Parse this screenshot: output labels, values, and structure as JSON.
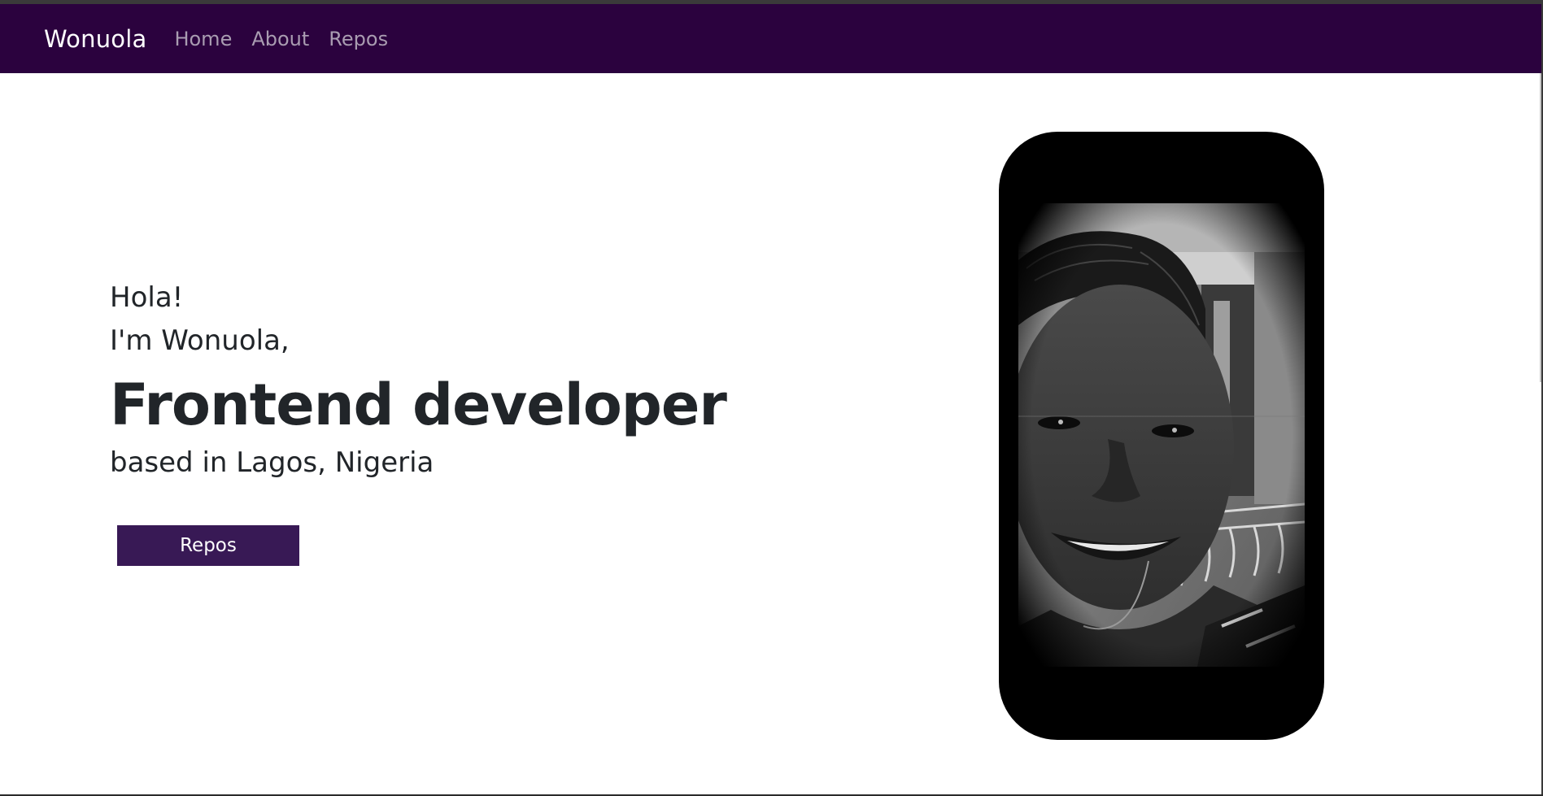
{
  "nav": {
    "brand": "Wonuola",
    "links": [
      {
        "label": "Home"
      },
      {
        "label": "About"
      },
      {
        "label": "Repos"
      }
    ],
    "background": "#2b023e"
  },
  "hero": {
    "greeting": "Hola!",
    "intro": "I'm Wonuola,",
    "role": "Frontend developer",
    "location": "based in Lagos, Nigeria",
    "cta_label": "Repos",
    "cta_color": "#381955"
  },
  "portrait": {
    "description_icon": "portrait-photo",
    "style": "black-and-white"
  }
}
